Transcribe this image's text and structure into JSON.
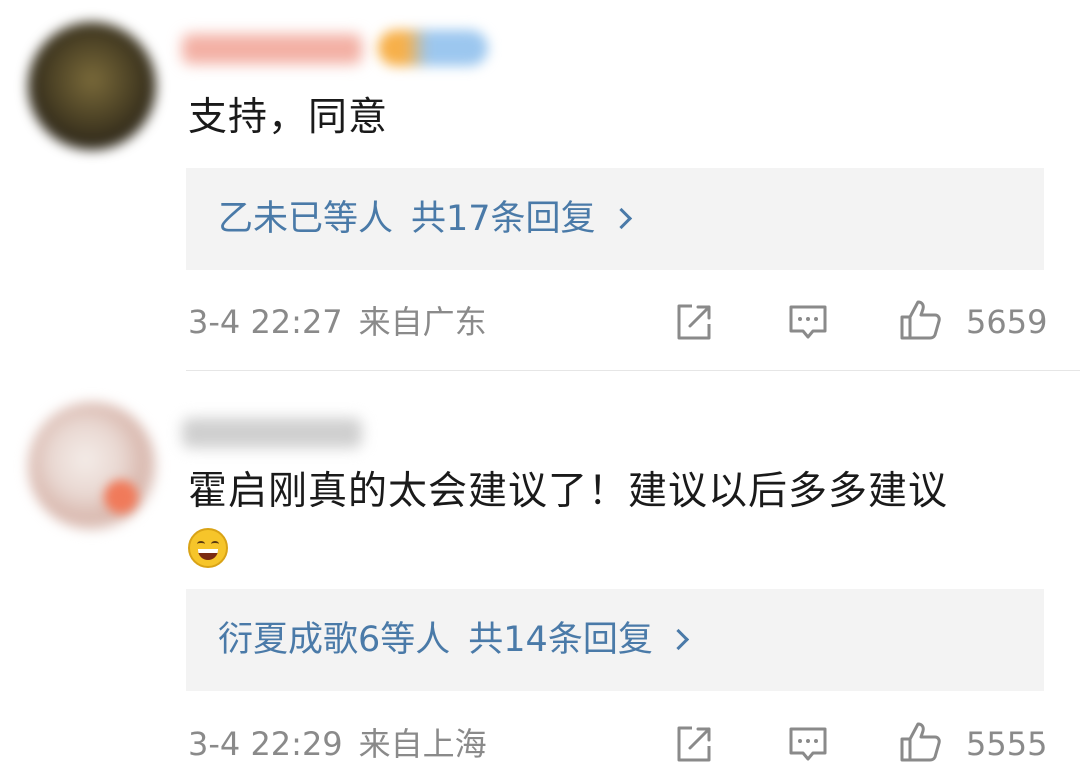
{
  "comments": [
    {
      "content": "支持，同意",
      "replies_names": "乙未已等人",
      "replies_count": "共17条回复",
      "time": "3-4 22:27",
      "location": "来自广东",
      "likes": "5659"
    },
    {
      "content": "霍启刚真的太会建议了！建议以后多多建议",
      "replies_names": "衍夏成歌6等人",
      "replies_count": "共14条回复",
      "time": "3-4 22:29",
      "location": "来自上海",
      "likes": "5555"
    }
  ],
  "icons": {
    "share": "share-icon",
    "reply": "comment-icon",
    "like": "thumbs-up-icon",
    "emoji": "laughing-emoji-icon",
    "chevron": "chevron-right-icon"
  },
  "colors": {
    "link": "#4a7aa8",
    "meta": "#8a8a8a",
    "reply_box_bg": "#f3f3f3"
  }
}
